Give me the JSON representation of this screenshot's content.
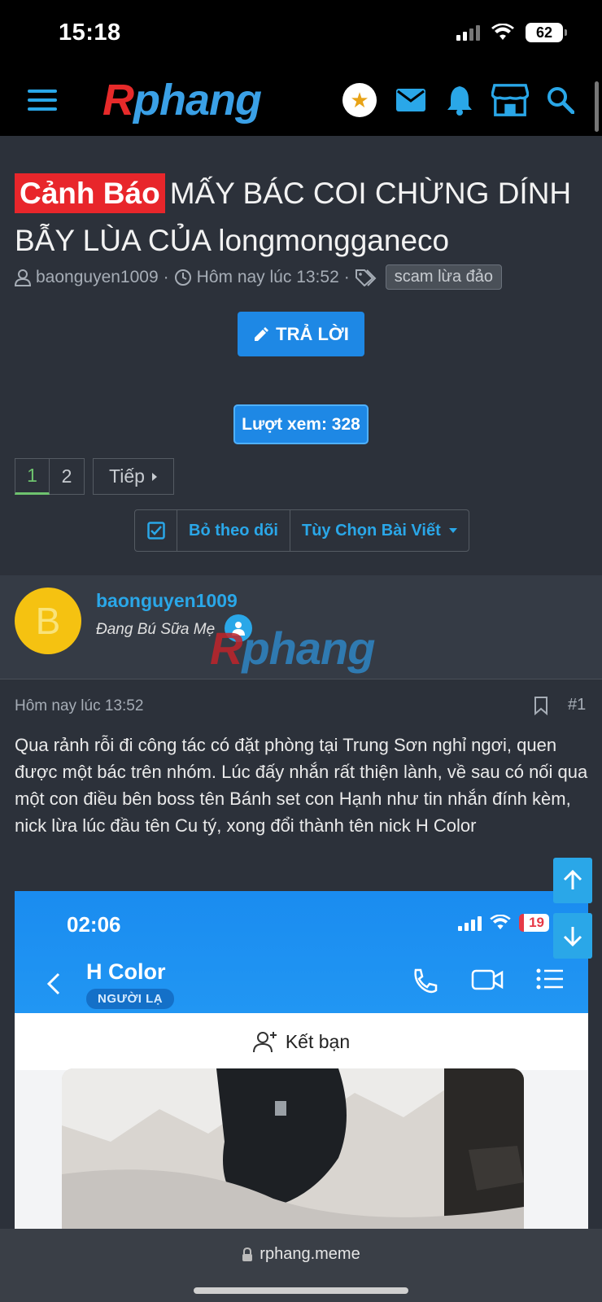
{
  "status_bar": {
    "time": "15:18",
    "battery": "62"
  },
  "header": {
    "logo_r": "R",
    "logo_rest": "phang",
    "icons": [
      "menu-icon",
      "avatar",
      "mail-icon",
      "bell-icon",
      "store-icon",
      "search-icon"
    ]
  },
  "thread": {
    "prefix": "Cảnh Báo",
    "title": "MẤY BÁC COI CHỪNG DÍNH BẪY LÙA CỦA longmongganeco",
    "author": "baonguyen1009",
    "date": "Hôm nay lúc 13:52",
    "tag": "scam lừa đảo",
    "reply_label": "TRẢ LỜI",
    "views_label": "Lượt xem: 328",
    "pages": [
      "1",
      "2"
    ],
    "next_label": "Tiếp",
    "unfollow_label": "Bỏ theo dõi",
    "options_label": "Tùy Chọn Bài Viết"
  },
  "post": {
    "avatar_letter": "B",
    "username": "baonguyen1009",
    "user_title": "Đang Bú Sữa Mẹ",
    "date": "Hôm nay lúc 13:52",
    "number": "#1",
    "body": "Qua rảnh rỗi đi công tác có đặt phòng tại Trung Sơn nghỉ ngơi, quen được một bác trên nhóm. Lúc đấy nhắn rất thiện lành, về sau có nối qua một con điều bên boss tên Bánh set con Hạnh như tin nhắn đính kèm, nick lừa lúc đầu tên Cu tý, xong đổi thành tên nick H Color"
  },
  "embed": {
    "time": "02:06",
    "battery": "19",
    "contact_name": "H Color",
    "chip": "NGƯỜI LẠ",
    "add_friend": "Kết bạn"
  },
  "browser": {
    "url": "rphang.meme"
  },
  "colors": {
    "accent": "#2aa7e8",
    "button": "#1e88e5",
    "prefix": "#e8262b",
    "bg": "#2c313a"
  }
}
